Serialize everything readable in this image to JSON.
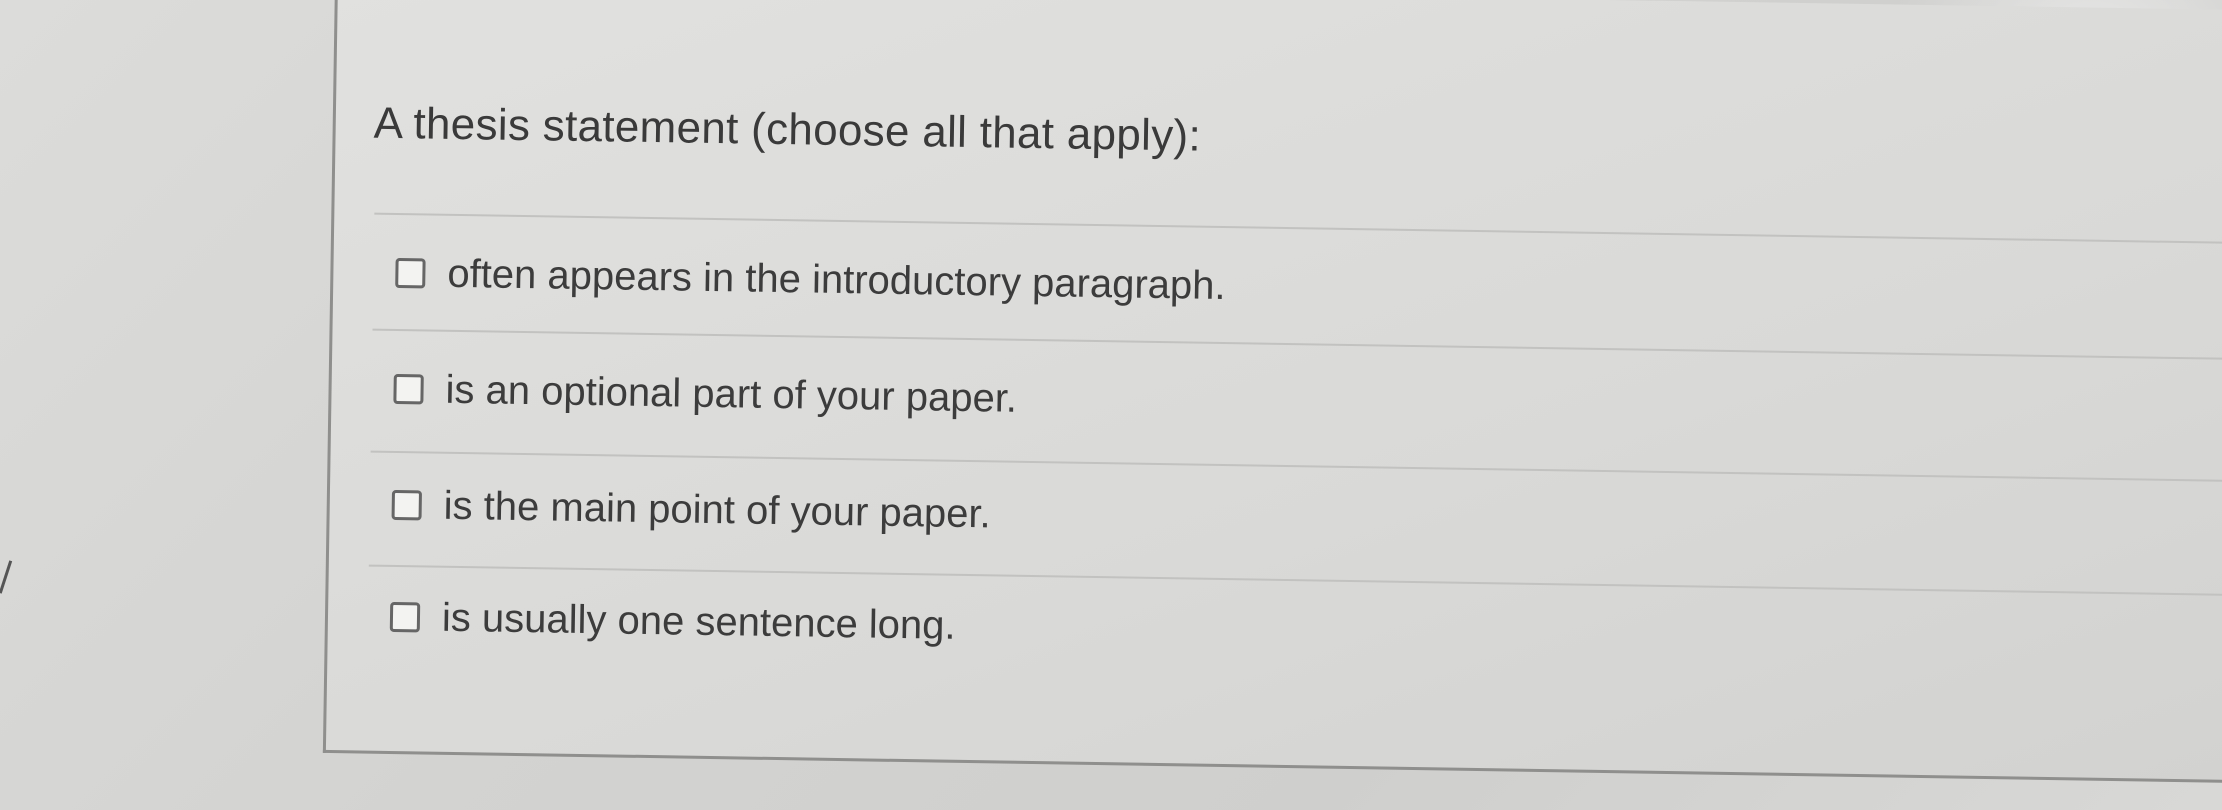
{
  "question": {
    "text": "A thesis statement  (choose all that apply):"
  },
  "options": [
    {
      "label": "often appears in the introductory paragraph.",
      "checked": false
    },
    {
      "label": "is an optional part of your paper.",
      "checked": false
    },
    {
      "label": "is the main point of your paper.",
      "checked": false
    },
    {
      "label": "is usually one sentence long.",
      "checked": false
    }
  ],
  "colors": {
    "text": "#3a3a3a",
    "background": "#d9d9d7",
    "border": "#8f8f8d"
  }
}
